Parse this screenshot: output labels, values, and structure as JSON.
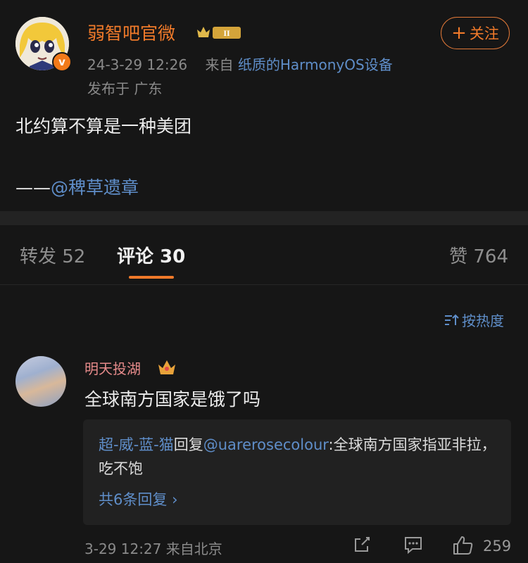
{
  "post": {
    "author": "弱智吧官微",
    "timestamp": "24-3-29 12:26",
    "source_prefix": "来自",
    "source": "纸质的HarmonyOS设备",
    "location": "发布于 广东",
    "follow_label": "关注",
    "text": "北约算不算是一种美团",
    "credit_dash": "——",
    "credit_mention": "@稗草遗章",
    "rank_badge": "II"
  },
  "tabs": [
    {
      "label": "转发 52"
    },
    {
      "label": "评论 30"
    },
    {
      "label": "赞 764"
    }
  ],
  "sort_label": "按热度",
  "comment": {
    "username": "明天投湖",
    "text": "全球南方国家是饿了吗",
    "reply_user": "超-威-蓝-猫",
    "reply_verb": "回复",
    "reply_target": "@uarerosecolour",
    "reply_text": ":全球南方国家指亚非拉，吃不饱",
    "more_replies": "共6条回复",
    "time": "3-29 12:27",
    "location": "来自北京",
    "likes": "259"
  },
  "colors": {
    "accent": "#f07a2a",
    "link": "#5f8ec9",
    "background": "#161616"
  }
}
